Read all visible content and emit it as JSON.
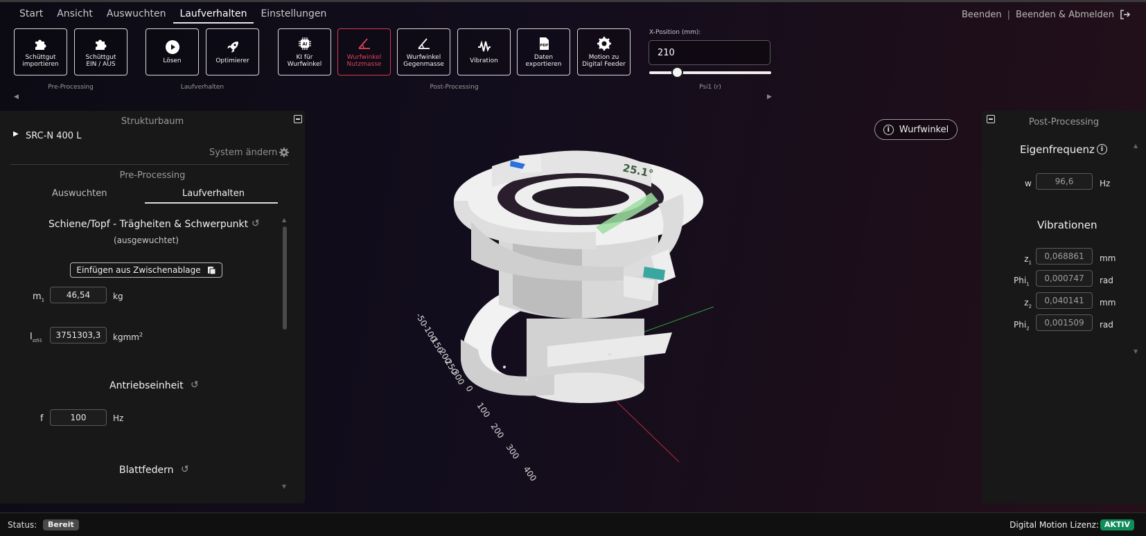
{
  "menu": {
    "items": [
      "Start",
      "Ansicht",
      "Auswuchten",
      "Laufverhalten",
      "Einstellungen"
    ],
    "active": "Laufverhalten"
  },
  "top_right": {
    "quit": "Beenden",
    "separator": "|",
    "quit_logout": "Beenden & Abmelden"
  },
  "toolbar": {
    "buttons": [
      {
        "label": "Schüttgut\nimportieren",
        "icon": "puzzle-icon"
      },
      {
        "label": "Schüttgut\nEIN / AUS",
        "icon": "puzzle-icon"
      },
      {
        "label": "Lösen",
        "icon": "play-icon"
      },
      {
        "label": "Optimierer",
        "icon": "rocket-icon"
      },
      {
        "label": "KI für\nWurfwinkel",
        "icon": "ai-chip-icon"
      },
      {
        "label": "Wurfwinkel\nNutzmasse",
        "icon": "angle-icon",
        "active": true
      },
      {
        "label": "Wurfwinkel\nGegenmasse",
        "icon": "angle-icon"
      },
      {
        "label": "Vibration",
        "icon": "vibration-icon"
      },
      {
        "label": "Daten\nexportieren",
        "icon": "pdf-icon"
      },
      {
        "label": "Motion zu\nDigital Feeder",
        "icon": "gear-icon"
      }
    ],
    "groups": [
      "Pre-Processing",
      "Laufverhalten",
      "Post-Processing",
      "Psi1 (r)"
    ],
    "x_position_label": "X-Position (mm):",
    "x_position_value": "210",
    "slider_fraction": 0.23,
    "accent_color": "#d43b4e"
  },
  "left_panel": {
    "title": "Strukturbaum",
    "tree_root": "SRC-N 400 L",
    "change_system": "System ändern",
    "section_title": "Pre-Processing",
    "tabs": [
      "Auswuchten",
      "Laufverhalten"
    ],
    "active_tab": "Laufverhalten",
    "inertia_title": "Schiene/Topf - Trägheiten & Schwerpunkt",
    "inertia_subtitle": "(ausgewuchtet)",
    "paste_button": "Einfügen aus Zwischenablage",
    "m1_label": "m",
    "m1_sub": "1",
    "m1_value": "46,54",
    "m1_unit": "kg",
    "izz_label": "I",
    "izz_sub": "zzS1",
    "izz_value": "3751303,3",
    "izz_unit": "kgmm",
    "izz_unit_sup": "2",
    "drive_title": "Antriebseinheit",
    "f_label": "f",
    "f_value": "100",
    "f_unit": "Hz",
    "springs_title": "Blattfedern"
  },
  "viewport": {
    "angle_button": "Wurfwinkel",
    "angle_readout": "25.1°",
    "axis_ticks_a": [
      "-50",
      "-100",
      "-150",
      "-200",
      "-250",
      "-300",
      "0"
    ],
    "axis_ticks_b": [
      "100",
      "200",
      "300",
      "400"
    ]
  },
  "right_panel": {
    "title": "Post-Processing",
    "eigen_title": "Eigenfrequenz",
    "w_label": "w",
    "w_value": "96,6",
    "w_unit": "Hz",
    "vib_title": "Vibrationen",
    "rows": [
      {
        "label": "z",
        "sub": "1",
        "value": "0,068861",
        "unit": "mm"
      },
      {
        "label": "Phi",
        "sub": "1",
        "value": "0,000747",
        "unit": "rad"
      },
      {
        "label": "z",
        "sub": "2",
        "value": "0,040141",
        "unit": "mm"
      },
      {
        "label": "Phi",
        "sub": "2",
        "value": "0,001509",
        "unit": "rad"
      }
    ]
  },
  "status_bar": {
    "status_label": "Status:",
    "status_value": "Bereit",
    "license_label": "Digital Motion Lizenz:",
    "license_value": "AKTIV",
    "license_color": "#0f8d5a"
  }
}
